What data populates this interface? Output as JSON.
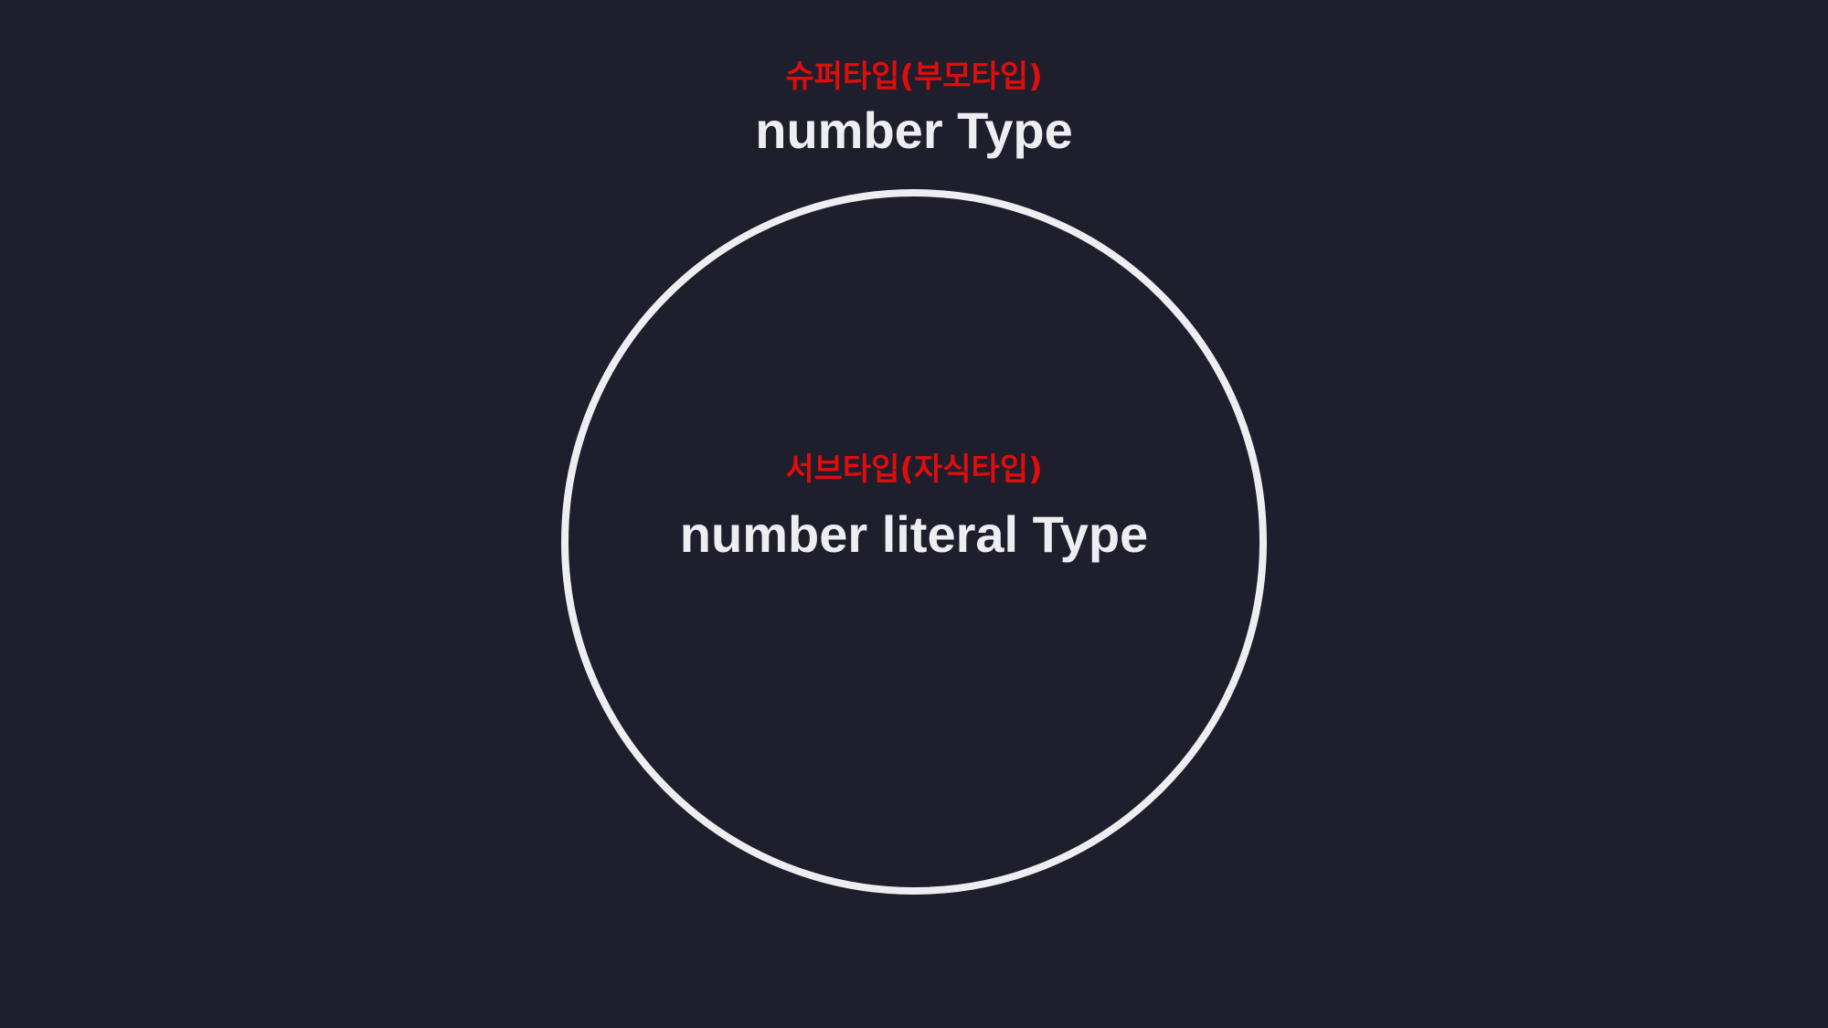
{
  "supertype": {
    "category": "슈퍼타입(부모타입)",
    "name": "number Type"
  },
  "subtype": {
    "category": "서브타입(자식타입)",
    "name": "number literal Type"
  },
  "colors": {
    "background": "#1e1e2c",
    "accent": "#e00d0d",
    "foreground": "#eeeef2"
  }
}
